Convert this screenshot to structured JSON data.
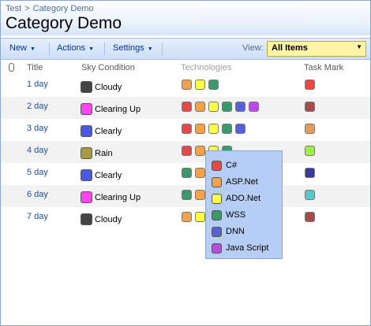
{
  "breadcrumb": {
    "root": "Test",
    "sep": ">",
    "current": "Category Demo"
  },
  "page_title": "Category Demo",
  "toolbar": {
    "new_label": "New",
    "actions_label": "Actions",
    "settings_label": "Settings",
    "view_label": "View:",
    "view_value": "All Items"
  },
  "columns": {
    "title": "Title",
    "sky": "Sky Condition",
    "tech": "Technologies",
    "mark": "Task Mark"
  },
  "colors": {
    "csharp": "#e84848",
    "aspnet": "#f4a24a",
    "adonet": "#ffff44",
    "wss": "#3a9a6e",
    "dnn": "#5560e0",
    "javascript": "#b94ae6",
    "cloudy": "#444444",
    "clearingup": "#ff44ee",
    "clearly": "#4a58e4",
    "rain": "#a89a3e",
    "mark_darkred": "#a84a4a",
    "mark_red": "#ee4444",
    "mark_orange": "#e89a5a",
    "mark_lime": "#9ef044",
    "mark_navy": "#3a3a9a",
    "mark_teal": "#5ac8c8"
  },
  "rows": [
    {
      "title": "1 day",
      "sky": "Cloudy",
      "sky_color": "#444444",
      "tech": [
        "#f4a24a",
        "#ffff44",
        "#3a9a6e"
      ],
      "mark": "#ee4444"
    },
    {
      "title": "2 day",
      "sky": "Clearing Up",
      "sky_color": "#ff44ee",
      "tech": [
        "#e84848",
        "#f4a24a",
        "#ffff44",
        "#3a9a6e",
        "#5560e0",
        "#b94ae6"
      ],
      "mark": "#a84a4a"
    },
    {
      "title": "3 day",
      "sky": "Clearly",
      "sky_color": "#4a58e4",
      "tech": [
        "#e84848",
        "#f4a24a",
        "#ffff44",
        "#3a9a6e",
        "#5560e0"
      ],
      "mark": "#e89a5a"
    },
    {
      "title": "4 day",
      "sky": "Rain",
      "sky_color": "#a89a3e",
      "tech": [
        "#e84848",
        "#f4a24a",
        "#ffff44",
        "#3a9a6e"
      ],
      "mark": "#9ef044"
    },
    {
      "title": "5 day",
      "sky": "Clearly",
      "sky_color": "#4a58e4",
      "tech": [
        "#3a9a6e",
        "#f4a24a"
      ],
      "mark": "#3a3a9a"
    },
    {
      "title": "6 day",
      "sky": "Clearing Up",
      "sky_color": "#ff44ee",
      "tech": [
        "#3a9a6e",
        "#f4a24a"
      ],
      "mark": "#5ac8c8"
    },
    {
      "title": "7 day",
      "sky": "Cloudy",
      "sky_color": "#444444",
      "tech": [
        "#f4a24a",
        "#ffff44"
      ],
      "mark": "#a84a4a"
    }
  ],
  "popup": [
    {
      "label": "C#",
      "color": "#e84848"
    },
    {
      "label": "ASP.Net",
      "color": "#f4a24a"
    },
    {
      "label": "ADO.Net",
      "color": "#ffff44"
    },
    {
      "label": "WSS",
      "color": "#3a9a6e"
    },
    {
      "label": "DNN",
      "color": "#5560e0"
    },
    {
      "label": "Java Script",
      "color": "#b94ae6"
    }
  ]
}
